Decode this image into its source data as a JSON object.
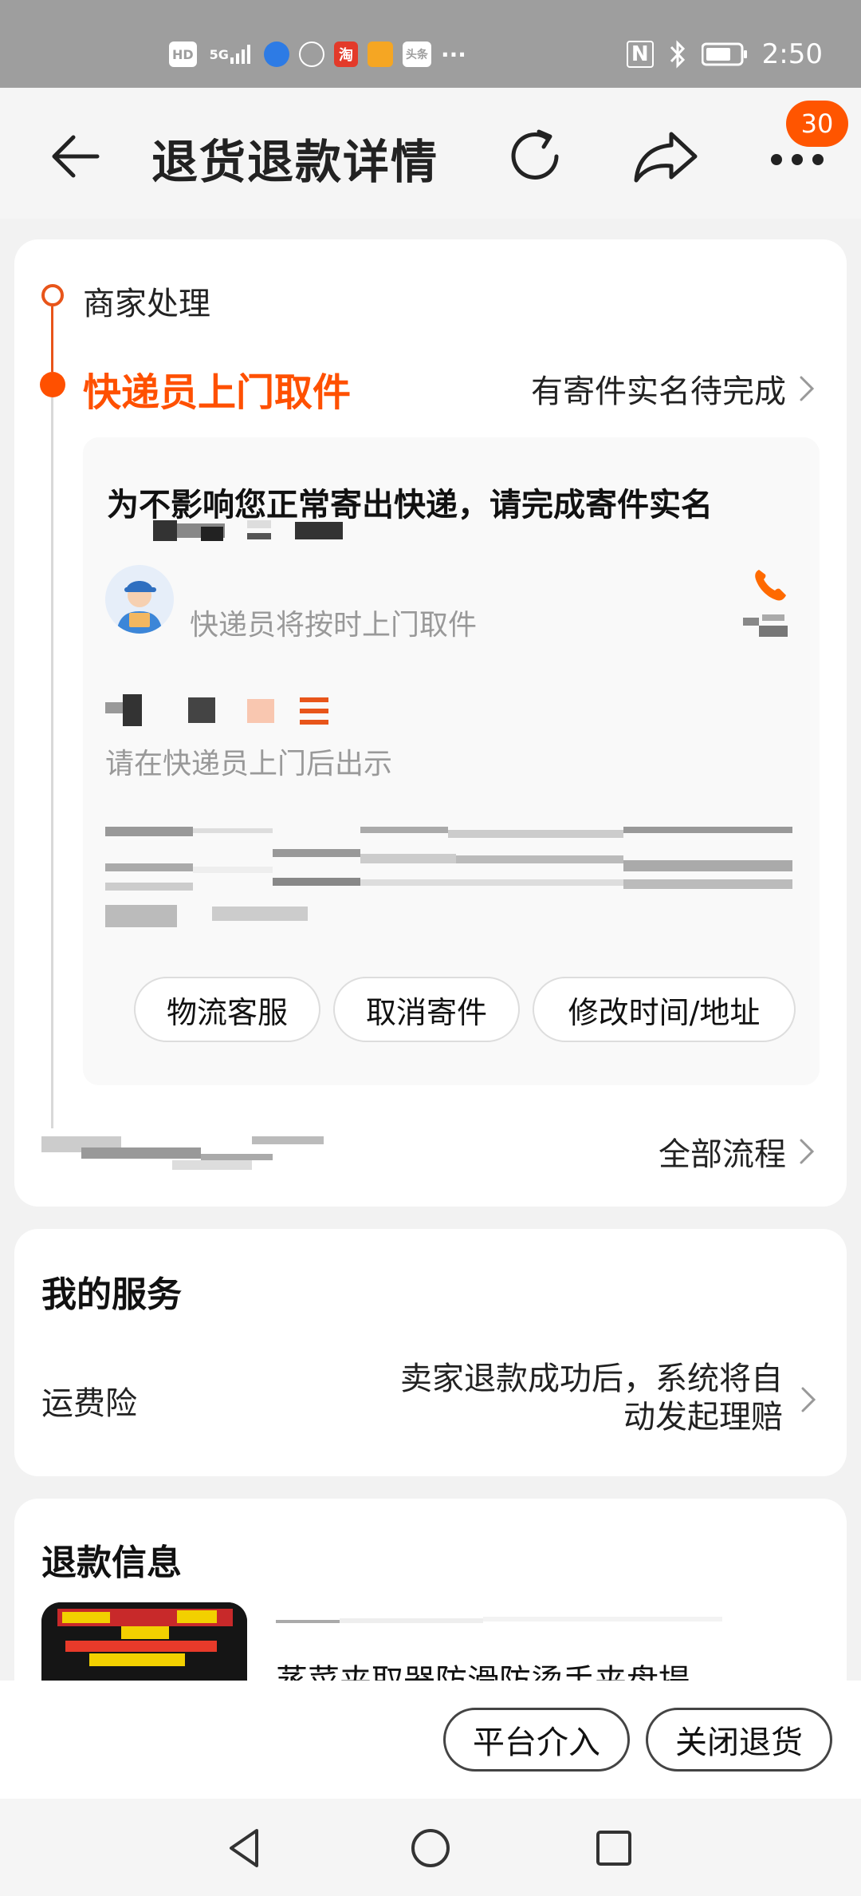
{
  "status_bar": {
    "hd": "HD",
    "net": "5G",
    "app_taobao": "淘",
    "app_toutiao": "头条",
    "more": "···",
    "nfc": "N",
    "time": "2:50"
  },
  "header": {
    "title": "退货退款详情",
    "badge_count": "30"
  },
  "timeline": {
    "step1": "商家处理",
    "step2": "快递员上门取件",
    "step2_link": "有寄件实名待完成",
    "notice": "为不影响您正常寄出快递，请完成寄件实名",
    "courier_status": "快递员将按时上门取件",
    "show_hint": "请在快递员上门后出示",
    "actions": [
      "物流客服",
      "取消寄件",
      "修改时间/地址"
    ],
    "all_flow": "全部流程"
  },
  "services": {
    "title": "我的服务",
    "item_label": "运费险",
    "item_desc": "卖家退款成功后，系统将自动发起理赔"
  },
  "refund": {
    "title": "退款信息",
    "product_name": "蒸菜夹取器防滑防烫手夹盘提"
  },
  "bottom": {
    "platform_btn": "平台介入",
    "close_btn": "关闭退货"
  },
  "colors": {
    "accent": "#ff5000",
    "badge": "#ff5500"
  }
}
